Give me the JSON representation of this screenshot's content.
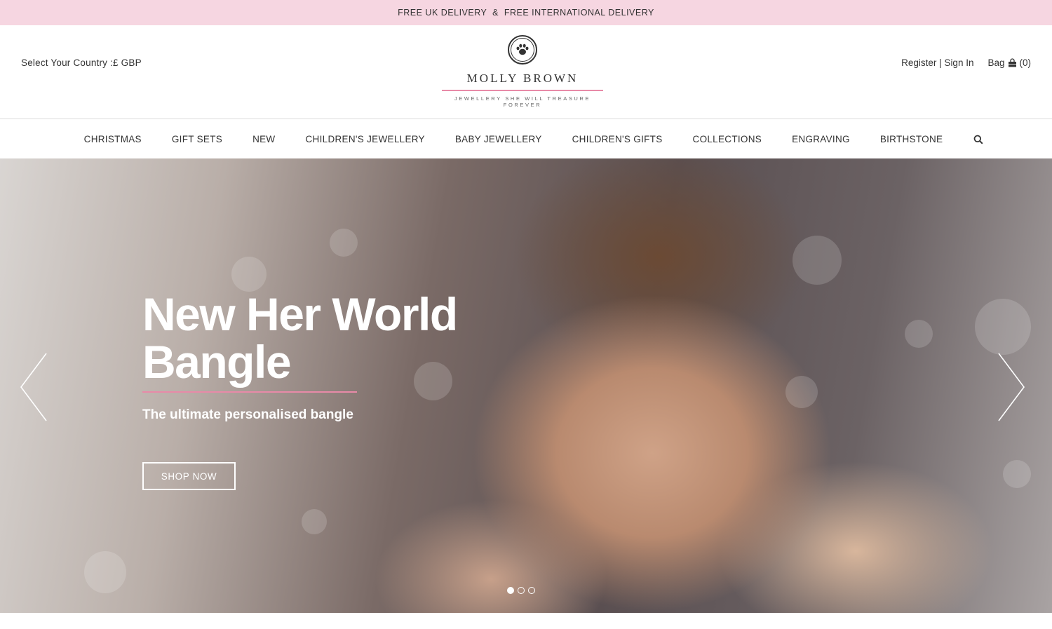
{
  "promo": {
    "text": "FREE UK DELIVERY  &  FREE INTERNATIONAL DELIVERY"
  },
  "header": {
    "country_label": "Select Your Country :£ GBP",
    "logo_name": "MOLLY BROWN",
    "logo_tagline": "JEWELLERY SHE WILL TREASURE FOREVER",
    "register_signin": "Register | Sign In",
    "bag_label": "Bag",
    "bag_count": "(0)"
  },
  "nav": {
    "items": [
      {
        "label": "CHRISTMAS"
      },
      {
        "label": "GIFT SETS"
      },
      {
        "label": "NEW"
      },
      {
        "label": "CHILDREN'S JEWELLERY"
      },
      {
        "label": "BABY JEWELLERY"
      },
      {
        "label": "CHILDREN'S GIFTS"
      },
      {
        "label": "COLLECTIONS"
      },
      {
        "label": "ENGRAVING"
      },
      {
        "label": "BIRTHSTONE"
      }
    ],
    "search_icon": "search-icon"
  },
  "hero": {
    "title": "New Her World Bangle",
    "subtitle": "The ultimate personalised bangle",
    "cta_label": "SHOP NOW",
    "slide_count": 3,
    "active_slide": 1
  },
  "colors": {
    "promo_bg": "#f6d6e1",
    "accent_pink": "#e88aa8",
    "text": "#333333"
  }
}
